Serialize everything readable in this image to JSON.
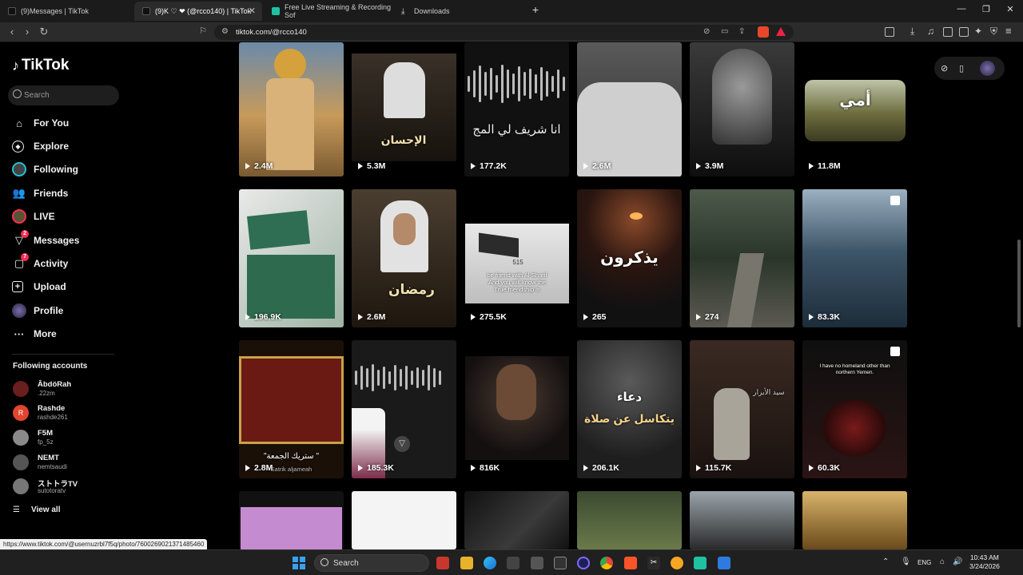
{
  "browser": {
    "tabs": [
      {
        "label": "(9)Messages | TikTok"
      },
      {
        "label": "(9)K ♡ ❤ (@rcco140) | TikTok"
      },
      {
        "label": "Free Live Streaming & Recording Sof"
      },
      {
        "label": "Downloads"
      }
    ],
    "url": "tiktok.com/@rcco140",
    "status_url": "https://www.tiktok.com/@usernuzrbl7f5q/photo/7600269021371485460"
  },
  "sidebar": {
    "logo": "TikTok",
    "search_placeholder": "Search",
    "nav": [
      {
        "label": "For You",
        "icon": "home-icon"
      },
      {
        "label": "Explore",
        "icon": "compass-icon"
      },
      {
        "label": "Following",
        "icon": "following-icon"
      },
      {
        "label": "Friends",
        "icon": "friends-icon"
      },
      {
        "label": "LIVE",
        "icon": "live-icon"
      },
      {
        "label": "Messages",
        "icon": "messages-icon",
        "badge": "2"
      },
      {
        "label": "Activity",
        "icon": "activity-icon",
        "badge": "7"
      },
      {
        "label": "Upload",
        "icon": "upload-icon"
      },
      {
        "label": "Profile",
        "icon": "profile-avatar"
      },
      {
        "label": "More",
        "icon": "more-icon"
      }
    ],
    "following_header": "Following accounts",
    "accounts": [
      {
        "name": "ÂbdöRah",
        "handle": ".22zm",
        "color": "#6b1e1e"
      },
      {
        "name": "Rashde",
        "handle": "rashde261",
        "color": "#e0452d",
        "initial": "R"
      },
      {
        "name": "F5M",
        "handle": "fp_5z",
        "color": "#8a8a8a"
      },
      {
        "name": "NEMT",
        "handle": "nemtsaudi",
        "color": "#555"
      },
      {
        "name": "ストトラTV",
        "handle": "sutotoratv",
        "color": "#777"
      }
    ],
    "view_all": "View all"
  },
  "grid": {
    "row1": [
      {
        "views": "2.4M"
      },
      {
        "views": "5.3M",
        "overlay": "الإحسان"
      },
      {
        "views": "177.2K",
        "overlay": "انا شريف لي المج"
      },
      {
        "views": "2.6M"
      },
      {
        "views": "3.9M"
      },
      {
        "views": "11.8M",
        "overlay": "أمي"
      }
    ],
    "row2": [
      {
        "views": "196.9K"
      },
      {
        "views": "2.6M",
        "overlay": "رمضان"
      },
      {
        "views": "275.5K",
        "overlay": "be friend with Al-Sharif\nAnd you will know the\nTrue friendship is",
        "overlay2": "515"
      },
      {
        "views": "265",
        "overlay": "يذكرون"
      },
      {
        "views": "274"
      },
      {
        "views": "83.3K"
      }
    ],
    "row3": [
      {
        "views": "2.8M",
        "overlay": "\"ستريك الجمعة \"",
        "overlay2": "Satrik aljameah"
      },
      {
        "views": "185.3K"
      },
      {
        "views": "816K"
      },
      {
        "views": "206.1K",
        "overlay": "دعاء",
        "overlay2": "يتكاسل عن صلاة"
      },
      {
        "views": "115.7K",
        "overlay": "سيد الأبرار"
      },
      {
        "views": "60.3K",
        "overlay": "I have no homeland other than\nnorthern Yemen."
      }
    ]
  },
  "taskbar": {
    "search_placeholder": "Search",
    "lang": "ENG",
    "time": "10:43 AM",
    "date": "3/24/2026"
  }
}
